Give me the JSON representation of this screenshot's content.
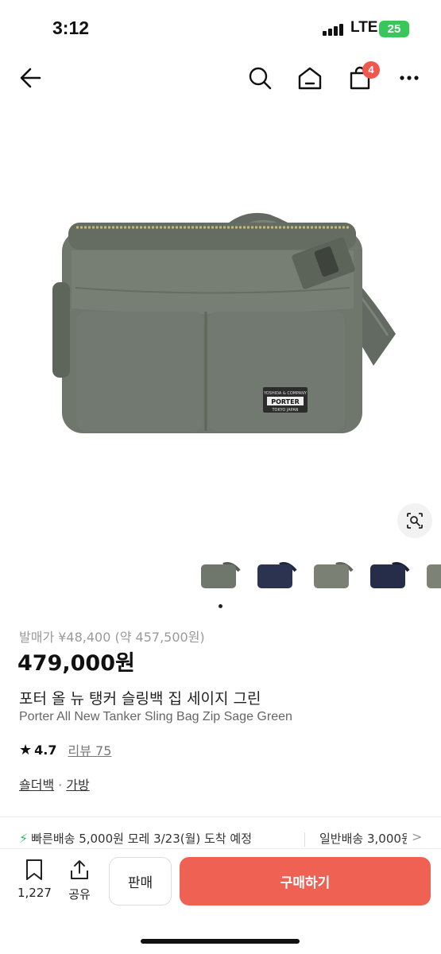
{
  "status": {
    "time": "3:12",
    "network": "LTE",
    "battery": "25"
  },
  "header": {
    "back_icon": "arrow-left-icon",
    "search_icon": "search-icon",
    "home_icon": "home-icon",
    "cart_icon": "shopping-bag-icon",
    "cart_count": "4",
    "more_icon": "more-dots-icon"
  },
  "gallery": {
    "thumbnails": [
      {
        "color": "#6f766c"
      },
      {
        "color": "#2c3350"
      },
      {
        "color": "#7a8074"
      },
      {
        "color": "#262d48"
      },
      {
        "color": "#7c8276"
      }
    ],
    "lens_icon": "image-search-icon"
  },
  "product": {
    "release_price": "발매가 ¥48,400 (약 457,500원)",
    "price": "479,000원",
    "title_ko": "포터 올 뉴 탱커 슬링백 집 세이지 그린",
    "title_en": "Porter All New Tanker Sling Bag Zip Sage Green",
    "rating": "4.7",
    "review_label": "리뷰 75",
    "category_1": "숄더백",
    "category_separator": "·",
    "category_2": "가방",
    "bag_label_top": "YOSHIDA & COMPANY",
    "bag_label_main": "PORTER",
    "bag_label_bottom": "TOKYO JAPAN"
  },
  "shipping": {
    "fast": "빠른배송 5,000원 모레 3/23(월) 도착 예정",
    "normal": "일반배송 3,000원"
  },
  "bottom": {
    "wish_count": "1,227",
    "share_label": "공유",
    "sell_label": "판매",
    "buy_label": "구매하기"
  },
  "colors": {
    "accent": "#ef6253",
    "badge": "#f0584d",
    "bag": "#6f766c"
  }
}
